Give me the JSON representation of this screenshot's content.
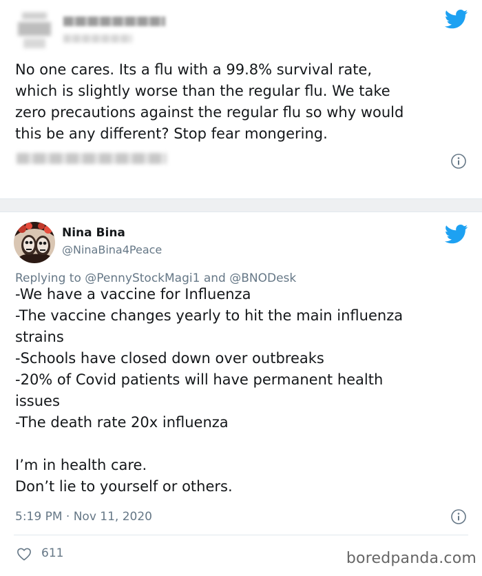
{
  "tweet1": {
    "text": "No one cares. Its a flu with a 99.8% survival rate,\nwhich is slightly worse than the regular flu. We take\nzero precautions against the regular flu so why would\nthis be any different? Stop fear mongering.",
    "icons": [
      "twitter-bird-icon",
      "info-icon"
    ],
    "colors": {
      "twitter_blue": "#1da1f2",
      "secondary": "#657786"
    }
  },
  "tweet2": {
    "author_name": "Nina Bina",
    "author_handle": "@NinaBina4Peace",
    "replying_to": "Replying to @PennyStockMagi1 and @BNODesk",
    "text": "-We have a vaccine for Influenza\n-The vaccine changes yearly to hit the main influenza\nstrains\n-Schools have closed down over outbreaks\n-20% of Covid patients will have permanent health\nissues\n-The death rate 20x influenza\n\nI’m in health care.\nDon’t lie to yourself or others.",
    "timestamp": "5:19 PM · Nov 11, 2020",
    "like_count": "611",
    "icons": [
      "twitter-bird-icon",
      "info-icon",
      "heart-icon"
    ]
  },
  "watermark": "boredpanda.com"
}
